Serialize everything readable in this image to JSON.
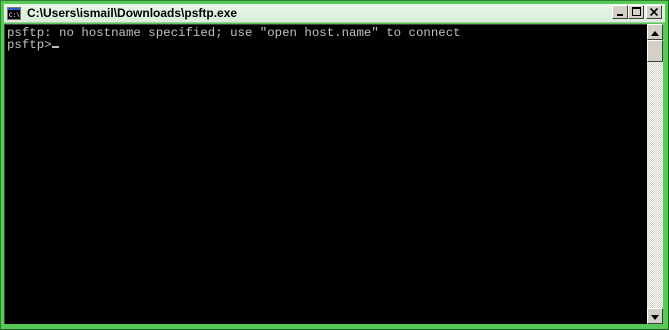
{
  "window": {
    "title": "C:\\Users\\ismail\\Downloads\\psftp.exe",
    "icon": "console-app-icon"
  },
  "caption_buttons": {
    "minimize_icon": "minimize-icon",
    "maximize_icon": "maximize-icon",
    "close_icon": "close-icon"
  },
  "console": {
    "lines": [
      "psftp: no hostname specified; use \"open host.name\" to connect",
      "psftp>"
    ],
    "background": "#000000",
    "foreground": "#c0c0c0"
  },
  "scrollbar": {
    "up_icon": "arrow-up-icon",
    "down_icon": "arrow-down-icon"
  },
  "theme": {
    "frame_color": "#57c957",
    "titlebar_color": "#e3f3e3"
  }
}
